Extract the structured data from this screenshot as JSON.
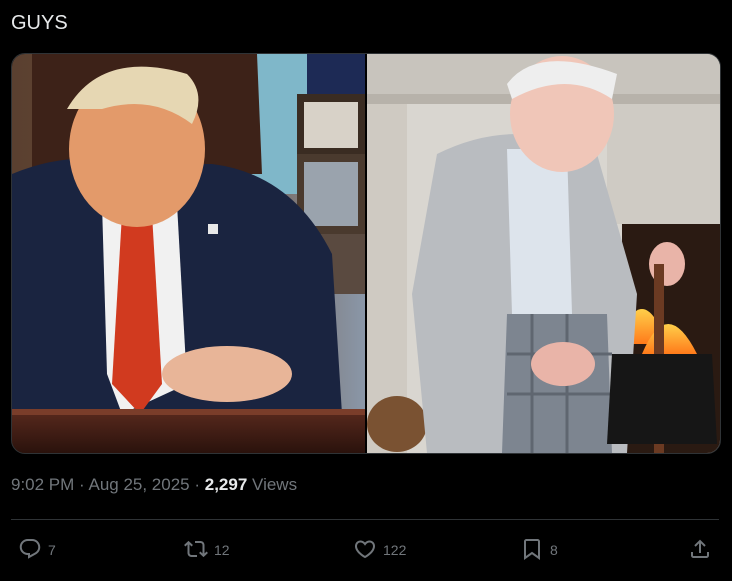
{
  "tweet": {
    "text": "GUYS"
  },
  "media": {
    "left_image_icon": "photo-man-at-desk",
    "right_image_icon": "photo-woman-with-cane"
  },
  "meta": {
    "time": "9:02 PM",
    "separator": " · ",
    "date": "Aug 25, 2025",
    "views_count": "2,297",
    "views_label": "Views"
  },
  "actions": {
    "reply_count": "7",
    "repost_count": "12",
    "like_count": "122",
    "bookmark_count": "8"
  },
  "colors": {
    "background": "#000000",
    "text_primary": "#e7e9ea",
    "text_secondary": "#71767b",
    "divider": "#2f3336"
  }
}
